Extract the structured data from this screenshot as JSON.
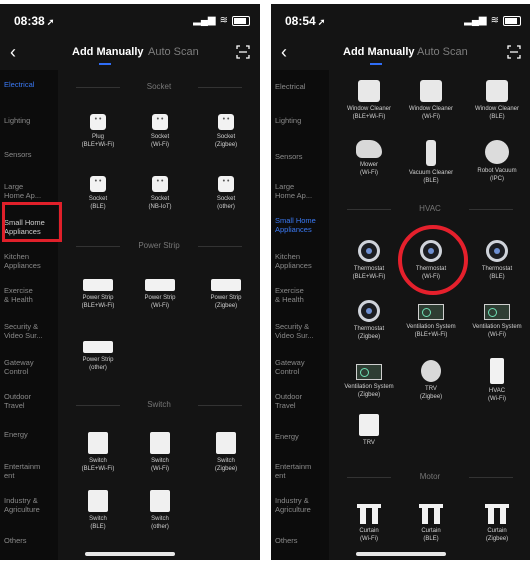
{
  "left": {
    "time": "08:38",
    "tabs": {
      "manual": "Add Manually",
      "scan": "Auto Scan"
    },
    "sidebar": [
      "Electrical",
      "Lighting",
      "Sensors",
      "Large\nHome Ap...",
      "Small Home\nAppliances",
      "Kitchen\nAppliances",
      "Exercise\n& Health",
      "Security &\nVideo Sur...",
      "Gateway\nControl",
      "Outdoor\nTravel",
      "Energy",
      "Entertainm\nent",
      "Industry &\nAgriculture",
      "Others"
    ],
    "sections": {
      "socket": "Socket",
      "strip": "Power Strip",
      "switch": "Switch"
    },
    "socket_items": [
      "Plug\n(BLE+Wi-Fi)",
      "Socket\n(Wi-Fi)",
      "Socket\n(Zigbee)",
      "Socket\n(BLE)",
      "Socket\n(NB-IoT)",
      "Socket\n(other)"
    ],
    "strip_items": [
      "Power Strip\n(BLE+Wi-Fi)",
      "Power Strip\n(Wi-Fi)",
      "Power Strip\n(Zigbee)",
      "Power Strip\n(other)"
    ],
    "switch_items": [
      "Switch\n(BLE+Wi-Fi)",
      "Switch\n(Wi-Fi)",
      "Switch\n(Zigbee)",
      "Switch\n(BLE)",
      "Switch\n(other)"
    ]
  },
  "right": {
    "time": "08:54",
    "tabs": {
      "manual": "Add Manually",
      "scan": "Auto Scan"
    },
    "sidebar": [
      "Electrical",
      "Lighting",
      "Sensors",
      "Large\nHome Ap...",
      "Small Home\nAppliances",
      "Kitchen\nAppliances",
      "Exercise\n& Health",
      "Security &\nVideo Sur...",
      "Gateway\nControl",
      "Outdoor\nTravel",
      "Energy",
      "Entertainm\nent",
      "Industry &\nAgriculture",
      "Others"
    ],
    "appliance_items": [
      "Window Cleaner\n(BLE+Wi-Fi)",
      "Window Cleaner\n(Wi-Fi)",
      "Window Cleaner\n(BLE)",
      "Mower\n(Wi-Fi)",
      "Vacuum Cleaner\n(BLE)",
      "Robot Vacuum\n(IPC)"
    ],
    "sections": {
      "hvac": "HVAC",
      "motor": "Motor"
    },
    "hvac_items": [
      "Thermostat\n(BLE+Wi-Fi)",
      "Thermostat\n(Wi-Fi)",
      "Thermostat\n(BLE)",
      "Thermostat\n(Zigbee)",
      "Ventilation System\n(BLE+Wi-Fi)",
      "Ventilation System\n(Wi-Fi)",
      "Ventilation System\n(Zigbee)",
      "TRV\n(Zigbee)",
      "HVAC\n(Wi-Fi)",
      "TRV"
    ],
    "motor_items": [
      "Curtain\n(Wi-Fi)",
      "Curtain\n(BLE)",
      "Curtain\n(Zigbee)"
    ]
  },
  "colors": {
    "accent": "#2f6df6",
    "highlight": "#e5202c",
    "background": "#141414"
  }
}
